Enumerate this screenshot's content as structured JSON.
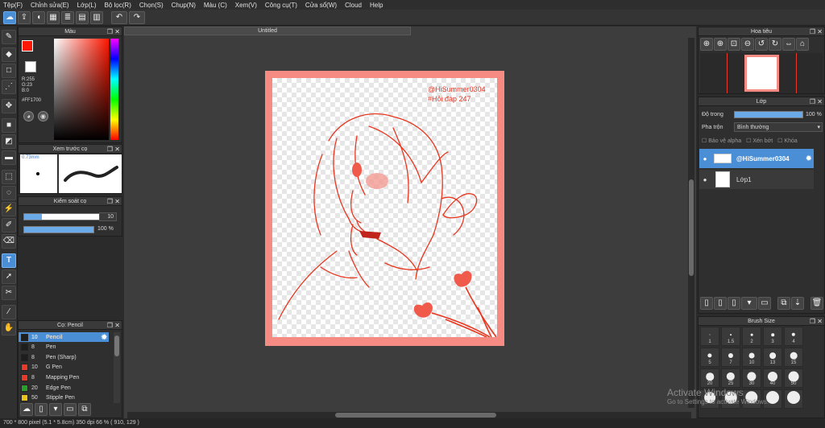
{
  "menu": [
    "Tệp(F)",
    "Chỉnh sửa(E)",
    "Lớp(L)",
    "Bộ lọc(R)",
    "Chọn(S)",
    "Chụp(N)",
    "Màu (C)",
    "Xem(V)",
    "Công cụ(T)",
    "Cửa sổ(W)",
    "Cloud",
    "Help"
  ],
  "document": {
    "title": "Untitled"
  },
  "color_panel": {
    "title": "Màu",
    "r": "R:255",
    "g": "G:23",
    "b": "B:0",
    "hex": "#FF1700",
    "primary": "#ff1700",
    "secondary": "#55c24a"
  },
  "brush_preview": {
    "title": "Xem trước cọ",
    "size": "0.73mm"
  },
  "brush_control": {
    "title": "Kiểm soát cọ",
    "size_value": "10",
    "opacity_value": "100 %",
    "size_fraction": 0.2,
    "opacity_fraction": 1.0
  },
  "brush_list": {
    "title": "Cọ: Pencil",
    "items": [
      {
        "size": "10",
        "name": "Pencil",
        "color": "#1e1e1e",
        "selected": true
      },
      {
        "size": "8",
        "name": "Pen",
        "color": "#1e1e1e"
      },
      {
        "size": "8",
        "name": "Pen (Sharp)",
        "color": "#1e1e1e"
      },
      {
        "size": "10",
        "name": "G Pen",
        "color": "#e83a2a"
      },
      {
        "size": "8",
        "name": "Mapping Pen",
        "color": "#e83a2a"
      },
      {
        "size": "20",
        "name": "Edge Pen",
        "color": "#2aa02a"
      },
      {
        "size": "50",
        "name": "Stipple Pen",
        "color": "#e8c21a"
      }
    ]
  },
  "artwork": {
    "signature_line1": "@HiSummer0304",
    "signature_line2": "#Hỏi đáp 247"
  },
  "navigator": {
    "title": "Hoa tiêu"
  },
  "layers": {
    "title": "Lớp",
    "opacity_label": "Độ trong",
    "opacity_value": "100 %",
    "opacity_fraction": 1.0,
    "blend_label": "Pha trộn",
    "blend_value": "Bình thường",
    "protect_alpha": "Bảo vệ alpha",
    "clipping": "Xén bớt",
    "lock": "Khóa",
    "items": [
      {
        "name": "@HiSummer0304",
        "selected": true
      },
      {
        "name": "Lớp1",
        "selected": false
      }
    ]
  },
  "brush_size": {
    "title": "Brush Size",
    "sizes": [
      [
        "1",
        "1.5",
        "2",
        "3",
        "4"
      ],
      [
        "5",
        "7",
        "10",
        "13",
        "15"
      ],
      [
        "20",
        "25",
        "30",
        "40",
        "50"
      ],
      [
        "",
        "",
        "",
        "",
        ""
      ]
    ]
  },
  "status": {
    "text": "700 * 800 pixel   (5.1 * 5.8cm)   350 dpi   66 %   ( 910, 129 )"
  },
  "watermark": {
    "line1": "Activate Windows",
    "line2": "Go to Settings to activate Windows."
  }
}
